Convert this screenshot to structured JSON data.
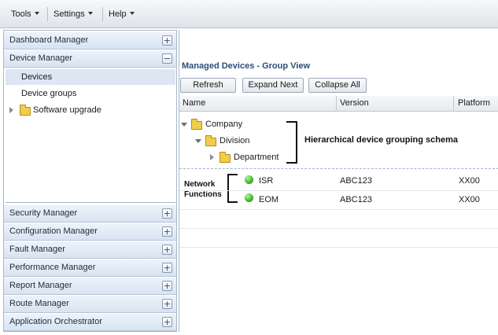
{
  "menubar": {
    "items": [
      {
        "label": "Tools"
      },
      {
        "label": "Settings"
      },
      {
        "label": "Help"
      }
    ]
  },
  "sidebar": {
    "sections_top": [
      {
        "label": "Dashboard Manager",
        "toggle": "+"
      },
      {
        "label": "Device Manager",
        "toggle": "−"
      }
    ],
    "device_items": [
      {
        "label": "Devices",
        "selected": true
      },
      {
        "label": "Device groups"
      },
      {
        "label": "Software upgrade"
      }
    ],
    "sections_bottom": [
      {
        "label": "Security Manager",
        "toggle": "+"
      },
      {
        "label": "Configuration Manager",
        "toggle": "+"
      },
      {
        "label": "Fault Manager",
        "toggle": "+"
      },
      {
        "label": "Performance Manager",
        "toggle": "+"
      },
      {
        "label": "Report Manager",
        "toggle": "+"
      },
      {
        "label": "Route Manager",
        "toggle": "+"
      },
      {
        "label": "Application Orchestrator",
        "toggle": "+"
      }
    ]
  },
  "main": {
    "title": "Managed Devices - Group View",
    "buttons": {
      "refresh": "Refresh",
      "expand_next": "Expand Next",
      "collapse_all": "Collapse All"
    },
    "columns": {
      "name": "Name",
      "version": "Version",
      "platform": "Platform"
    },
    "tree": {
      "company": "Company",
      "division": "Division",
      "department": "Department"
    },
    "annotations": {
      "hierarchy": "Hierarchical device grouping schema",
      "network_functions_line1": "Network",
      "network_functions_line2": "Functions"
    },
    "rows": [
      {
        "name": "ISR",
        "version": "ABC123",
        "platform": "XX00"
      },
      {
        "name": "EOM",
        "version": "ABC123",
        "platform": "XX00"
      }
    ]
  },
  "colors": {
    "accent": "#2b4d7a",
    "status_ok": "#3cb52a",
    "folder": "#f1cc4d"
  }
}
